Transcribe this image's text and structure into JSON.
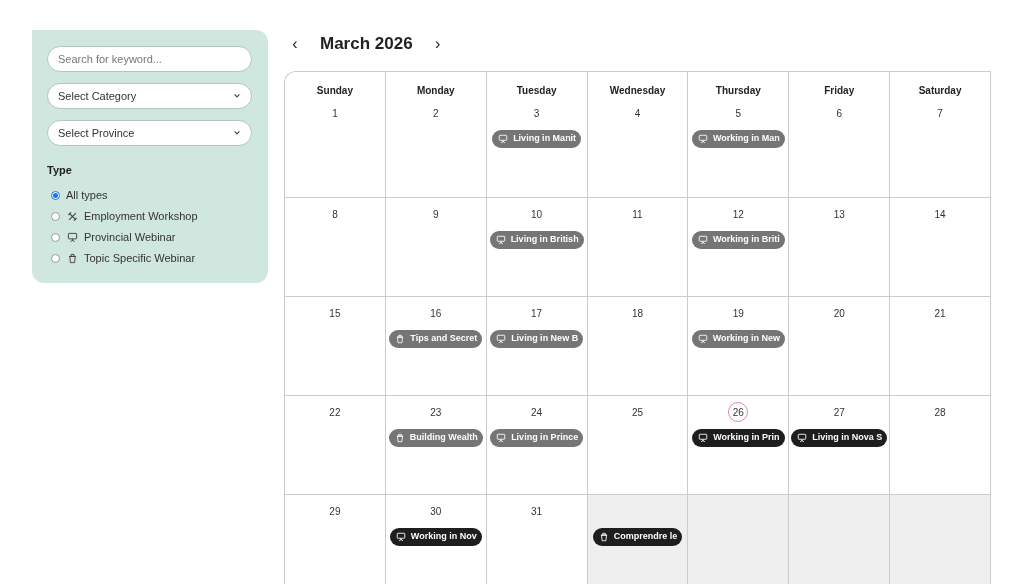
{
  "sidebar": {
    "search": {
      "placeholder": "Search for keyword..."
    },
    "selects": [
      {
        "label": "Select Category"
      },
      {
        "label": "Select Province"
      }
    ],
    "type_heading": "Type",
    "types": [
      {
        "label": "All types",
        "selected": true
      },
      {
        "label": "Employment Workshop",
        "selected": false,
        "kind": "workshop"
      },
      {
        "label": "Provincial Webinar",
        "selected": false,
        "kind": "webinar"
      },
      {
        "label": "Topic Specific Webinar",
        "selected": false,
        "kind": "topic"
      }
    ]
  },
  "calendar": {
    "prev": "‹",
    "title": "March 2026",
    "next": "›",
    "weekdays": [
      "Sunday",
      "Monday",
      "Tuesday",
      "Wednesday",
      "Thursday",
      "Friday",
      "Saturday"
    ],
    "weeks": [
      [
        {
          "day": "1"
        },
        {
          "day": "2"
        },
        {
          "day": "3",
          "events": [
            {
              "title": "Living in Manit",
              "kind": "webinar",
              "past": true
            }
          ]
        },
        {
          "day": "4"
        },
        {
          "day": "5",
          "events": [
            {
              "title": "Working in Man",
              "kind": "webinar",
              "past": true
            }
          ]
        },
        {
          "day": "6"
        },
        {
          "day": "7"
        }
      ],
      [
        {
          "day": "8"
        },
        {
          "day": "9"
        },
        {
          "day": "10",
          "events": [
            {
              "title": "Living in British",
              "kind": "webinar",
              "past": true
            }
          ]
        },
        {
          "day": "11"
        },
        {
          "day": "12",
          "events": [
            {
              "title": "Working in Briti",
              "kind": "webinar",
              "past": true
            }
          ]
        },
        {
          "day": "13"
        },
        {
          "day": "14"
        }
      ],
      [
        {
          "day": "15"
        },
        {
          "day": "16",
          "events": [
            {
              "title": "Tips and Secret",
              "kind": "topic",
              "past": true
            }
          ]
        },
        {
          "day": "17",
          "events": [
            {
              "title": "Living in New B",
              "kind": "webinar",
              "past": true
            }
          ]
        },
        {
          "day": "18"
        },
        {
          "day": "19",
          "events": [
            {
              "title": "Working in New",
              "kind": "webinar",
              "past": true
            }
          ]
        },
        {
          "day": "20"
        },
        {
          "day": "21"
        }
      ],
      [
        {
          "day": "22"
        },
        {
          "day": "23",
          "events": [
            {
              "title": "Building Wealth",
              "kind": "topic",
              "past": true
            }
          ]
        },
        {
          "day": "24",
          "events": [
            {
              "title": "Living in Prince",
              "kind": "webinar",
              "past": true
            }
          ]
        },
        {
          "day": "25"
        },
        {
          "day": "26",
          "today": true,
          "events": [
            {
              "title": "Working in Prin",
              "kind": "webinar",
              "past": false
            }
          ]
        },
        {
          "day": "27",
          "events": [
            {
              "title": "Living in Nova S",
              "kind": "webinar",
              "past": false
            }
          ]
        },
        {
          "day": "28"
        }
      ],
      [
        {
          "day": "29"
        },
        {
          "day": "30",
          "events": [
            {
              "title": "Working in Nov",
              "kind": "webinar",
              "past": false
            }
          ]
        },
        {
          "day": "31"
        },
        {
          "outside": true,
          "events": [
            {
              "title": "Comprendre le",
              "kind": "topic",
              "past": false
            }
          ]
        },
        {
          "outside": true
        },
        {
          "outside": true
        },
        {
          "outside": true
        }
      ]
    ]
  }
}
